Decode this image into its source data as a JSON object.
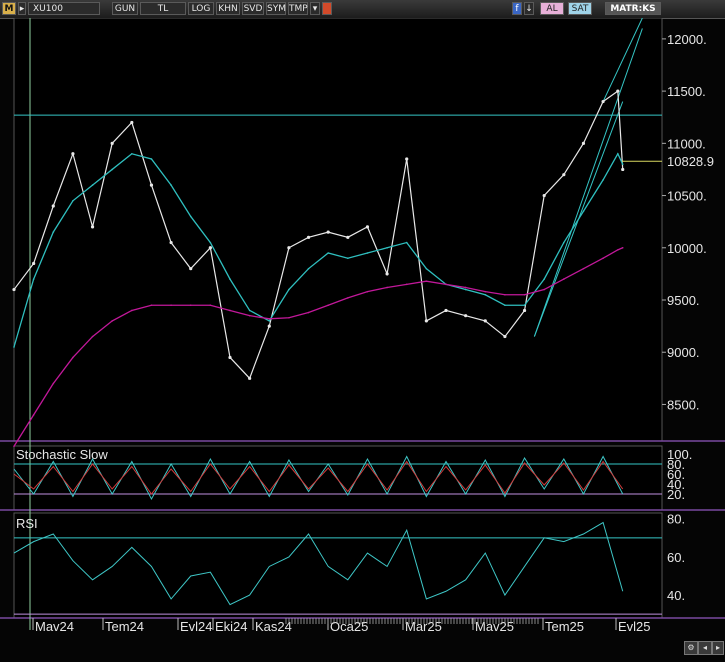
{
  "toolbar": {
    "logo": "M",
    "symbol": "XU100",
    "buttons": [
      "GUN",
      "TL",
      "LOG",
      "KHN",
      "SVD",
      "SYM",
      "TMP"
    ],
    "al_label": "AL",
    "sat_label": "SAT",
    "matrix_label": "MATR:KS"
  },
  "colors": {
    "price": "#e8e8e8",
    "ma_short": "#2fbfbf",
    "ma_long": "#c2189a",
    "h_line": "#35c6c6",
    "level_band": "#c090e0",
    "stoch_k": "#3ec6c6",
    "stoch_d": "#d23a3a",
    "rsi": "#3ec6c6"
  },
  "chart_data": [
    {
      "type": "line",
      "title": "",
      "ylim": [
        8150,
        12200
      ],
      "yticks": [
        12000,
        11500,
        11000,
        10500,
        10000,
        9500,
        9000,
        8500
      ],
      "ytick_labels": [
        "12000.",
        "11500.",
        "11000.",
        "10500.",
        "10000.",
        "9500.",
        "9000.",
        "8500."
      ],
      "last_value_label": "10828.9",
      "last_value": 10828.9,
      "horizontal_line": 11270,
      "x": [
        0,
        20,
        40,
        60,
        80,
        100,
        120,
        140,
        160,
        180,
        200,
        220,
        240,
        260,
        280,
        300,
        320,
        340,
        360,
        380,
        400,
        420,
        440,
        460,
        480,
        500,
        520,
        540,
        560,
        580,
        600,
        615,
        620
      ],
      "series": [
        {
          "values": [
            9600,
            9850,
            10400,
            10900,
            10200,
            11000,
            11200,
            10600,
            10050,
            9800,
            10000,
            8950,
            8750,
            9250,
            10000,
            10100,
            10150,
            10100,
            10200,
            9750,
            10850,
            9300,
            9400,
            9350,
            9300,
            9150,
            9400,
            10500,
            10700,
            11000,
            11400,
            11500,
            10750
          ]
        },
        {
          "values": [
            9050,
            9700,
            10150,
            10450,
            10600,
            10750,
            10900,
            10850,
            10600,
            10300,
            10050,
            9700,
            9400,
            9300,
            9600,
            9800,
            9950,
            9900,
            9950,
            10000,
            10050,
            9800,
            9650,
            9600,
            9550,
            9450,
            9450,
            9700,
            10050,
            10350,
            10650,
            10900,
            10800
          ]
        },
        {
          "values": [
            8100,
            8400,
            8700,
            8950,
            9150,
            9300,
            9400,
            9450,
            9450,
            9450,
            9450,
            9400,
            9350,
            9320,
            9330,
            9380,
            9450,
            9520,
            9580,
            9620,
            9650,
            9680,
            9650,
            9620,
            9580,
            9550,
            9550,
            9600,
            9700,
            9800,
            9900,
            9980,
            10000
          ]
        }
      ],
      "trend_lines": [
        {
          "from": [
            530,
            9150
          ],
          "to": [
            640,
            12100
          ]
        },
        {
          "from": [
            530,
            9150
          ],
          "to": [
            620,
            11400
          ]
        },
        {
          "from": [
            600,
            11400
          ],
          "to": [
            640,
            12200
          ]
        }
      ]
    },
    {
      "type": "line",
      "title": "Stochastic Slow",
      "ylim": [
        0,
        100
      ],
      "yticks": [
        100,
        80,
        60,
        40,
        20
      ],
      "ytick_labels": [
        "100.",
        "80.",
        "60.",
        "40.",
        "20."
      ],
      "bands": [
        80,
        20
      ],
      "x": [
        0,
        20,
        40,
        60,
        80,
        100,
        120,
        140,
        160,
        180,
        200,
        220,
        240,
        260,
        280,
        300,
        320,
        340,
        360,
        380,
        400,
        420,
        440,
        460,
        480,
        500,
        520,
        540,
        560,
        580,
        600,
        620
      ],
      "series": [
        {
          "values": [
            70,
            20,
            85,
            15,
            90,
            20,
            85,
            10,
            80,
            15,
            90,
            20,
            85,
            15,
            88,
            25,
            80,
            18,
            90,
            20,
            95,
            15,
            85,
            20,
            88,
            15,
            92,
            30,
            90,
            20,
            95,
            20
          ]
        },
        {
          "values": [
            60,
            30,
            75,
            25,
            80,
            30,
            75,
            20,
            70,
            25,
            80,
            30,
            75,
            25,
            78,
            30,
            72,
            25,
            80,
            28,
            85,
            25,
            75,
            28,
            78,
            22,
            82,
            38,
            82,
            28,
            85,
            30
          ]
        }
      ]
    },
    {
      "type": "line",
      "title": "RSI",
      "ylim": [
        28,
        83
      ],
      "yticks": [
        80,
        60,
        40
      ],
      "ytick_labels": [
        "80.",
        "60.",
        "40."
      ],
      "bands": [
        70,
        30
      ],
      "x": [
        0,
        20,
        40,
        60,
        80,
        100,
        120,
        140,
        160,
        180,
        200,
        220,
        240,
        260,
        280,
        300,
        320,
        340,
        360,
        380,
        400,
        420,
        440,
        460,
        480,
        500,
        520,
        540,
        560,
        580,
        600,
        620
      ],
      "series": [
        {
          "values": [
            62,
            68,
            72,
            58,
            48,
            55,
            65,
            55,
            38,
            50,
            52,
            35,
            40,
            55,
            60,
            72,
            55,
            48,
            62,
            55,
            74,
            38,
            42,
            48,
            62,
            40,
            55,
            70,
            68,
            72,
            78,
            42
          ]
        }
      ]
    }
  ],
  "xaxis": {
    "labels": [
      "Mav24",
      "Tem24",
      "Evl24",
      "Eki24",
      "Kas24",
      "Oca25",
      "Mar25",
      "Mav25",
      "Tem25",
      "Evl25"
    ],
    "positions": [
      35,
      105,
      180,
      215,
      255,
      330,
      405,
      475,
      545,
      618
    ]
  }
}
